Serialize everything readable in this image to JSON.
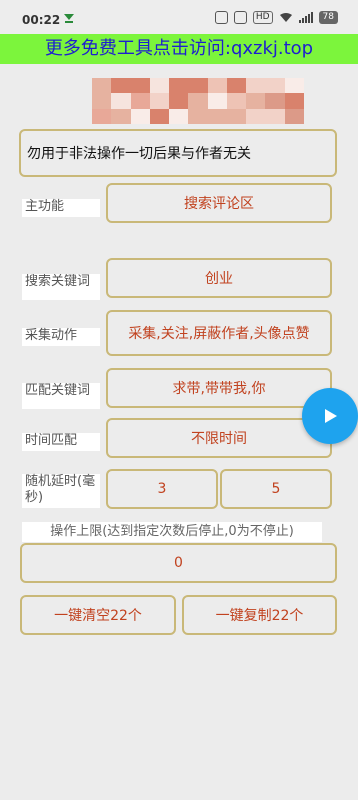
{
  "status": {
    "time": "00:22",
    "battery": "78"
  },
  "banner": {
    "text": "更多免费工具点击访问:qxzkj.top"
  },
  "notice": "勿用于非法操作一切后果与作者无关",
  "main_function": {
    "label": "主功能",
    "value": "搜索评论区"
  },
  "search_keyword": {
    "label": "搜索关键词",
    "value": "创业"
  },
  "collect_action": {
    "label": "采集动作",
    "value": "采集,关注,屏蔽作者,头像点赞"
  },
  "match_keyword": {
    "label": "匹配关键词",
    "value": "求带,带带我,你"
  },
  "time_match": {
    "label": "时间匹配",
    "value": "不限时间"
  },
  "random_delay": {
    "label": "随机延时(毫秒)",
    "min": "3",
    "max": "5"
  },
  "operation_limit": {
    "label": "操作上限(达到指定次数后停止,0为不停止)",
    "value": "0"
  },
  "actions": {
    "clear": "一键清空22个",
    "copy": "一键复制22个"
  },
  "colors": {
    "banner_bg": "#7cf53c",
    "banner_text": "#1d1fcf",
    "value_text": "#c1421f",
    "border": "#c9b878",
    "fab": "#1ea3ee"
  },
  "icons": {
    "fab": "play-icon"
  }
}
